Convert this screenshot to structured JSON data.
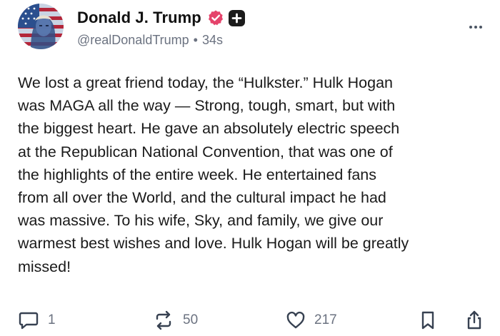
{
  "post": {
    "author": {
      "display_name": "Donald J. Trump",
      "handle": "@realDonaldTrump",
      "separator": "•",
      "timestamp": "34s",
      "avatar_icon": "flag-portrait-avatar",
      "verified_icon": "verified-badge-icon",
      "verified_color": "#e5436b",
      "plus_icon": "plus-badge-icon"
    },
    "menu_icon": "more-options-icon",
    "text": "We lost a great friend today, the “Hulkster.” Hulk Hogan\nwas MAGA all the way — Strong, tough, smart, but with\nthe biggest heart. He gave an absolutely electric speech\nat the Republican National Convention, that was one of\nthe highlights of the entire week. He entertained fans\nfrom all over the World, and the cultural impact he had\nwas massive. To his wife, Sky, and family, we give our\nwarmest best wishes and love. Hulk Hogan will be greatly\nmissed!",
    "actions": {
      "reply": {
        "icon": "reply-icon",
        "count": "1"
      },
      "repost": {
        "icon": "repost-icon",
        "count": "50"
      },
      "like": {
        "icon": "heart-icon",
        "count": "217"
      },
      "bookmark": {
        "icon": "bookmark-icon"
      },
      "share": {
        "icon": "share-icon"
      }
    }
  }
}
